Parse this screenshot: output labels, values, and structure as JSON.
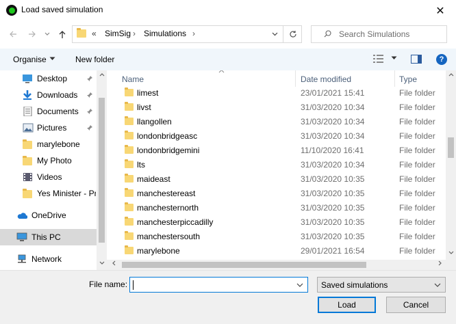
{
  "window": {
    "title": "Load saved simulation",
    "close_glyph": "✕"
  },
  "address": {
    "overflow": "«",
    "crumbs": [
      "SimSig",
      "Simulations"
    ],
    "separator": "›",
    "search_placeholder": "Search Simulations"
  },
  "toolbar": {
    "organise_label": "Organise",
    "new_folder_label": "New folder",
    "help_glyph": "?"
  },
  "nav": {
    "items": [
      {
        "label": "Desktop",
        "icon": "desktop-icon",
        "pinned": true
      },
      {
        "label": "Downloads",
        "icon": "download-icon",
        "pinned": true
      },
      {
        "label": "Documents",
        "icon": "documents-icon",
        "pinned": true
      },
      {
        "label": "Pictures",
        "icon": "pictures-icon",
        "pinned": true
      },
      {
        "label": "marylebone",
        "icon": "folder-icon",
        "pinned": false
      },
      {
        "label": "My Photo",
        "icon": "folder-icon",
        "pinned": false
      },
      {
        "label": "Videos",
        "icon": "videos-icon",
        "pinned": false
      },
      {
        "label": "Yes Minister - Pr",
        "icon": "folder-icon",
        "pinned": false
      },
      {
        "label": "OneDrive",
        "icon": "onedrive-icon",
        "pinned": false
      },
      {
        "label": "This PC",
        "icon": "this-pc-icon",
        "pinned": false,
        "selected": true
      },
      {
        "label": "Network",
        "icon": "network-icon",
        "pinned": false
      }
    ]
  },
  "files": {
    "columns": {
      "name": "Name",
      "date": "Date modified",
      "type": "Type"
    },
    "rows": [
      {
        "name": "limest",
        "date": "23/01/2021 15:41",
        "type": "File folder"
      },
      {
        "name": "livst",
        "date": "31/03/2020 10:34",
        "type": "File folder"
      },
      {
        "name": "llangollen",
        "date": "31/03/2020 10:34",
        "type": "File folder"
      },
      {
        "name": "londonbridgeasc",
        "date": "31/03/2020 10:34",
        "type": "File folder"
      },
      {
        "name": "londonbridgemini",
        "date": "11/10/2020 16:41",
        "type": "File folder"
      },
      {
        "name": "lts",
        "date": "31/03/2020 10:34",
        "type": "File folder"
      },
      {
        "name": "maideast",
        "date": "31/03/2020 10:35",
        "type": "File folder"
      },
      {
        "name": "manchestereast",
        "date": "31/03/2020 10:35",
        "type": "File folder"
      },
      {
        "name": "manchesternorth",
        "date": "31/03/2020 10:35",
        "type": "File folder"
      },
      {
        "name": "manchesterpiccadilly",
        "date": "31/03/2020 10:35",
        "type": "File folder"
      },
      {
        "name": "manchestersouth",
        "date": "31/03/2020 10:35",
        "type": "File folder"
      },
      {
        "name": "marylebone",
        "date": "29/01/2021 16:54",
        "type": "File folder"
      }
    ]
  },
  "bottom": {
    "file_name_label": "File name:",
    "file_name_value": "",
    "file_type": "Saved simulations",
    "load_label": "Load",
    "cancel_label": "Cancel"
  },
  "colors": {
    "accent": "#0078d7",
    "folder": "#f8d775",
    "toolbar_bg": "#f0f6fb"
  }
}
